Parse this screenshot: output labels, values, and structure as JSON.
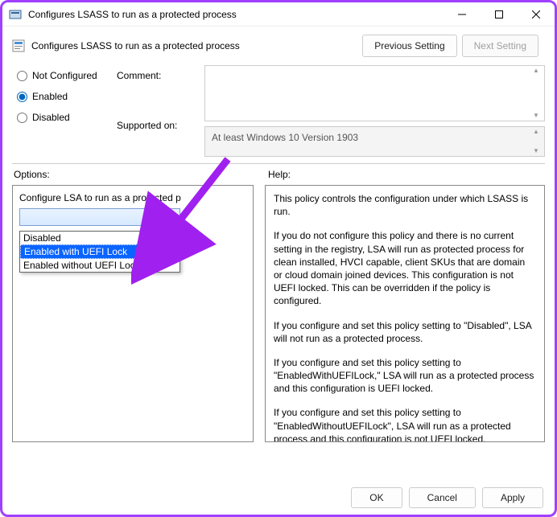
{
  "window": {
    "title": "Configures LSASS to run as a protected process"
  },
  "header": {
    "policy_title": "Configures LSASS to run as a protected process",
    "prev_label": "Previous Setting",
    "next_label": "Next Setting"
  },
  "state_radios": {
    "not_configured": "Not Configured",
    "enabled": "Enabled",
    "disabled": "Disabled",
    "selected": "enabled"
  },
  "fields": {
    "comment_label": "Comment:",
    "comment_value": "",
    "supported_label": "Supported on:",
    "supported_value": "At least Windows 10 Version 1903"
  },
  "sections": {
    "options_label": "Options:",
    "help_label": "Help:"
  },
  "option_block": {
    "label": "Configure LSA to run as a protected p",
    "combo_value": "",
    "options": [
      "Disabled",
      "Enabled with UEFI Lock",
      "Enabled without UEFI Lock"
    ],
    "selected_index": 1
  },
  "help": {
    "p1": "This policy controls the configuration under which LSASS is run.",
    "p2": "If you do not configure this policy and there is no current setting in the registry, LSA will run as protected process for clean installed, HVCI capable, client SKUs that are domain or cloud domain joined devices. This configuration is not UEFI locked. This can be overridden if the policy is configured.",
    "p3": "If you configure and set this policy setting to \"Disabled\", LSA will not run as a protected process.",
    "p4": "If you configure and set this policy setting to \"EnabledWithUEFILock,\" LSA will run as a protected process and this configuration is UEFI locked.",
    "p5": "If you configure and set this policy setting to \"EnabledWithoutUEFILock\", LSA will run as a protected process and this configuration is not UEFI locked."
  },
  "footer": {
    "ok": "OK",
    "cancel": "Cancel",
    "apply": "Apply"
  }
}
